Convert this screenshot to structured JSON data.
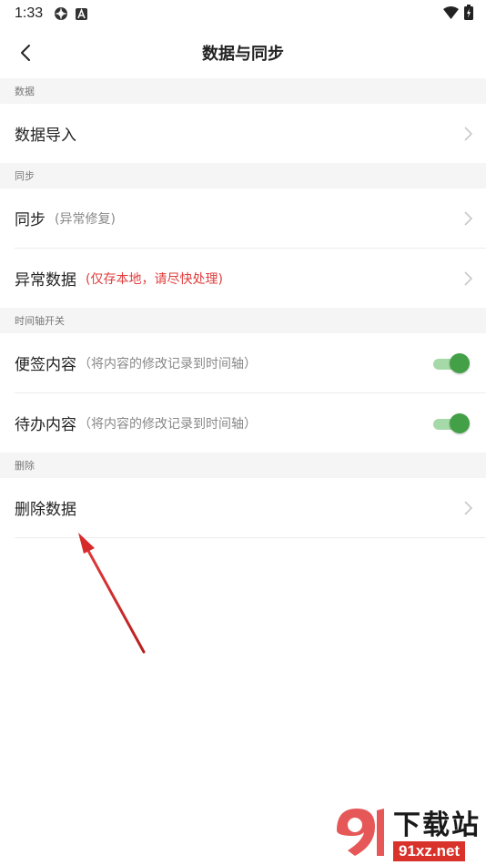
{
  "status_bar": {
    "time": "1:33",
    "icons": [
      "settings-gear-icon",
      "a-app-icon",
      "wifi-icon",
      "battery-charging-icon"
    ]
  },
  "header": {
    "title": "数据与同步",
    "back_icon": "back-arrow-icon"
  },
  "sections": {
    "data": {
      "header": "数据",
      "import_label": "数据导入"
    },
    "sync": {
      "header": "同步",
      "sync_label": "同步",
      "sync_note": "(异常修复)",
      "abnormal_label": "异常数据",
      "abnormal_note": "(仅存本地，请尽快处理)"
    },
    "timeline": {
      "header": "时间轴开关",
      "notes_label": "便签内容",
      "notes_desc": "（将内容的修改记录到时间轴）",
      "notes_toggle": true,
      "todo_label": "待办内容",
      "todo_desc": "（将内容的修改记录到时间轴）",
      "todo_toggle": true
    },
    "delete": {
      "header": "删除",
      "delete_label": "删除数据"
    }
  },
  "colors": {
    "accent_red": "#e03c3c",
    "toggle_green": "#43a047",
    "annotation_arrow": "#d62b2b",
    "section_bg": "#f5f5f5"
  },
  "watermark": {
    "title": "下载站",
    "url": "91xz.net"
  }
}
